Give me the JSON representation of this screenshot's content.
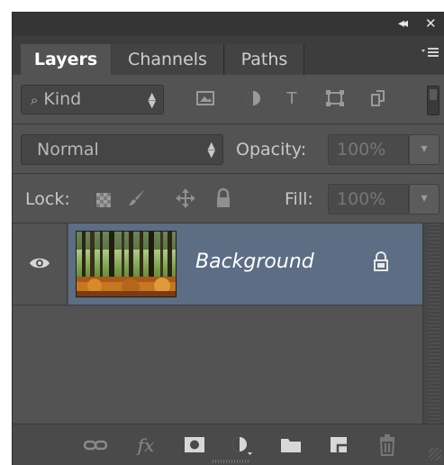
{
  "panel": {
    "title_strip": {
      "collapse_label": "◂◂",
      "close_label": "✕"
    },
    "tabs": [
      {
        "label": "Layers",
        "active": true
      },
      {
        "label": "Channels",
        "active": false
      },
      {
        "label": "Paths",
        "active": false
      }
    ],
    "menu_icon": "panel-menu-icon"
  },
  "filter_row": {
    "kind_label": "Kind",
    "search_glyph": "⌕",
    "filter_icons": [
      "image-filter-icon",
      "adjustment-filter-icon",
      "type-filter-icon",
      "shape-filter-icon",
      "smart-object-filter-icon"
    ],
    "type_glyph": "T"
  },
  "blend_row": {
    "mode": "Normal",
    "opacity_label": "Opacity:",
    "opacity_value": "100%"
  },
  "lock_row": {
    "lock_label": "Lock:",
    "fill_label": "Fill:",
    "fill_value": "100%"
  },
  "layers": [
    {
      "name": "Background",
      "visible": true,
      "locked": true,
      "selected": true
    }
  ],
  "footer": {
    "icons": [
      "link-layers-icon",
      "fx-icon",
      "add-mask-icon",
      "adjustment-layer-icon",
      "new-group-icon",
      "new-layer-icon",
      "delete-layer-icon"
    ],
    "fx_label": "fx"
  },
  "colors": {
    "panel_bg": "#535353",
    "selected_layer": "#5c6d84",
    "tab_bar": "#3d3d3d"
  }
}
